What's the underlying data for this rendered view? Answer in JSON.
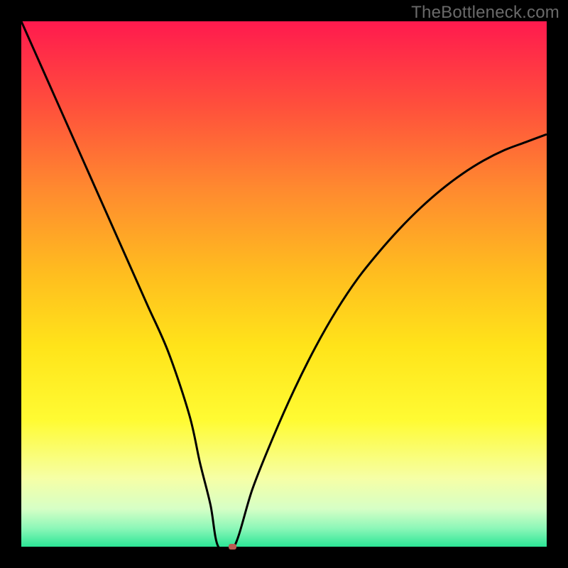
{
  "watermark": "TheBottleneck.com",
  "chart_data": {
    "type": "line",
    "title": "",
    "xlabel": "",
    "ylabel": "",
    "xlim": [
      0,
      100
    ],
    "ylim": [
      0,
      100
    ],
    "x": [
      0,
      4,
      8,
      12,
      16,
      20,
      24,
      28,
      32,
      34,
      36,
      37.5,
      40.5,
      44,
      48,
      52,
      56,
      60,
      64,
      68,
      72,
      76,
      80,
      84,
      88,
      92,
      96,
      100
    ],
    "values": [
      100,
      91,
      82,
      73,
      64,
      55,
      46,
      37,
      25,
      16,
      8,
      0,
      0,
      11,
      21,
      30,
      38,
      45,
      51,
      56,
      60.5,
      64.5,
      68,
      71,
      73.5,
      75.5,
      77,
      78.5
    ],
    "gradient_stops": [
      {
        "offset": 0.0,
        "color": "#ff1a4e"
      },
      {
        "offset": 0.16,
        "color": "#ff4f3c"
      },
      {
        "offset": 0.32,
        "color": "#ff8a2f"
      },
      {
        "offset": 0.48,
        "color": "#ffbd1f"
      },
      {
        "offset": 0.62,
        "color": "#ffe41a"
      },
      {
        "offset": 0.76,
        "color": "#fffb33"
      },
      {
        "offset": 0.87,
        "color": "#f6ffa6"
      },
      {
        "offset": 0.928,
        "color": "#d6ffc6"
      },
      {
        "offset": 0.965,
        "color": "#8cf7b8"
      },
      {
        "offset": 1.0,
        "color": "#2ce596"
      }
    ],
    "curve_color": "#000000",
    "marker": {
      "x": 40.2,
      "y": 0,
      "w_pct": 1.4,
      "h_pct": 1.0,
      "color": "#bb5b52"
    }
  }
}
